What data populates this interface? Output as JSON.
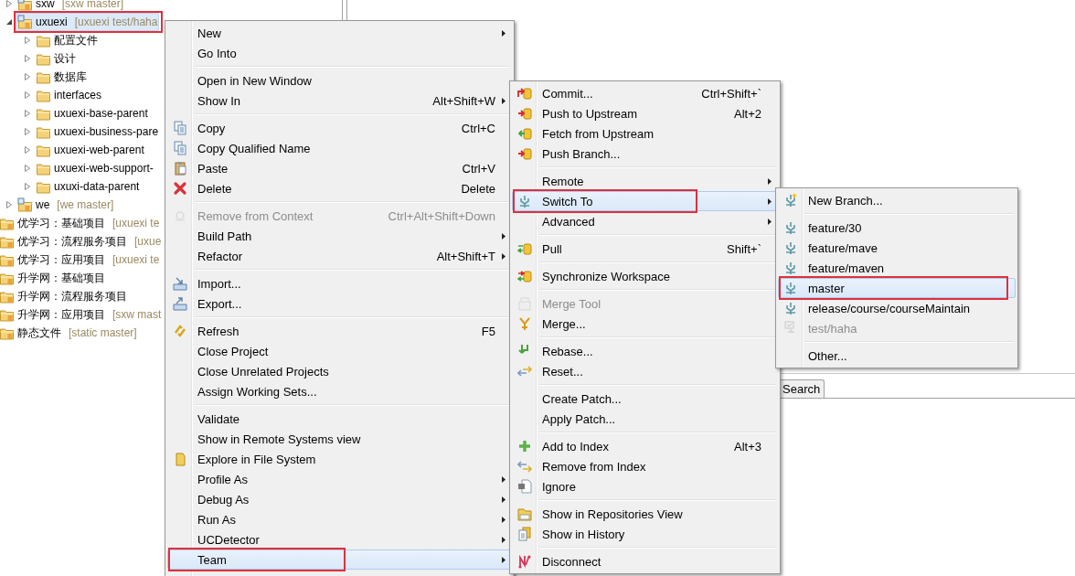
{
  "tree": [
    {
      "kind": "project",
      "label": "sxw",
      "branch": "[sxw master]",
      "expanded": false,
      "selected": false,
      "annotated": false
    },
    {
      "kind": "project",
      "label": "uxuexi",
      "branch": "[uxuexi test/haha",
      "expanded": true,
      "selected": true,
      "annotated": true,
      "children": [
        {
          "kind": "folder",
          "label": "配置文件",
          "expanded": false,
          "selected": false,
          "annotated": false
        },
        {
          "kind": "folder",
          "label": "设计",
          "expanded": false,
          "selected": false,
          "annotated": false
        },
        {
          "kind": "folder",
          "label": "数据库",
          "expanded": false,
          "selected": false,
          "annotated": false
        },
        {
          "kind": "folder",
          "label": "interfaces",
          "expanded": false,
          "selected": false,
          "annotated": false
        },
        {
          "kind": "folder",
          "label": "uxuexi-base-parent",
          "expanded": false,
          "selected": false,
          "annotated": false
        },
        {
          "kind": "folder",
          "label": "uxuexi-business-pare",
          "expanded": false,
          "selected": false,
          "annotated": false
        },
        {
          "kind": "folder",
          "label": "uxuexi-web-parent",
          "expanded": false,
          "selected": false,
          "annotated": false
        },
        {
          "kind": "folder",
          "label": "uxuexi-web-support-",
          "expanded": false,
          "selected": false,
          "annotated": false
        },
        {
          "kind": "folder",
          "label": "uxuxi-data-parent",
          "expanded": false,
          "selected": false,
          "annotated": false
        }
      ]
    },
    {
      "kind": "project",
      "label": "we",
      "branch": "[we master]",
      "expanded": false,
      "selected": false,
      "annotated": false
    },
    {
      "kind": "set",
      "label": "优学习：基础项目",
      "branch": "[uxuexi te",
      "selected": false,
      "annotated": false
    },
    {
      "kind": "set",
      "label": "优学习：流程服务项目",
      "branch": "[uxue",
      "selected": false,
      "annotated": false
    },
    {
      "kind": "set",
      "label": "优学习：应用项目",
      "branch": "[uxuexi te",
      "selected": false,
      "annotated": false
    },
    {
      "kind": "set",
      "label": "升学网：基础项目",
      "selected": false,
      "annotated": false
    },
    {
      "kind": "set",
      "label": "升学网：流程服务项目",
      "selected": false,
      "annotated": false
    },
    {
      "kind": "set",
      "label": "升学网：应用项目",
      "branch": "[sxw mast",
      "selected": false,
      "annotated": false
    },
    {
      "kind": "set",
      "label": "静态文件",
      "branch": "[static master]",
      "selected": false,
      "annotated": false
    }
  ],
  "bottom_tabs": [
    {
      "label": "Search",
      "selected": false
    }
  ],
  "menus": [
    {
      "items": [
        {
          "kind": "item",
          "label": "New",
          "submenu": true,
          "icon": false,
          "disabled": false,
          "selected": false,
          "annotated": false
        },
        {
          "kind": "item",
          "label": "Go Into",
          "submenu": false,
          "icon": false,
          "disabled": false,
          "selected": false,
          "annotated": false
        },
        {
          "kind": "separator"
        },
        {
          "kind": "item",
          "label": "Open in New Window",
          "submenu": false,
          "icon": false,
          "disabled": false,
          "selected": false,
          "annotated": false
        },
        {
          "kind": "item",
          "label": "Show In",
          "shortcut": "Alt+Shift+W",
          "submenu": true,
          "icon": false,
          "disabled": false,
          "selected": false,
          "annotated": false
        },
        {
          "kind": "separator"
        },
        {
          "kind": "item",
          "label": "Copy",
          "shortcut": "Ctrl+C",
          "submenu": false,
          "icon": true,
          "disabled": false,
          "selected": false,
          "annotated": false
        },
        {
          "kind": "item",
          "label": "Copy Qualified Name",
          "submenu": false,
          "icon": true,
          "disabled": false,
          "selected": false,
          "annotated": false
        },
        {
          "kind": "item",
          "label": "Paste",
          "shortcut": "Ctrl+V",
          "submenu": false,
          "icon": true,
          "disabled": false,
          "selected": false,
          "annotated": false
        },
        {
          "kind": "item",
          "label": "Delete",
          "shortcut": "Delete",
          "submenu": false,
          "icon": true,
          "disabled": false,
          "selected": false,
          "annotated": false
        },
        {
          "kind": "separator"
        },
        {
          "kind": "item",
          "label": "Remove from Context",
          "shortcut": "Ctrl+Alt+Shift+Down",
          "submenu": false,
          "icon": true,
          "disabled": true,
          "selected": false,
          "annotated": false
        },
        {
          "kind": "item",
          "label": "Build Path",
          "submenu": true,
          "icon": false,
          "disabled": false,
          "selected": false,
          "annotated": false
        },
        {
          "kind": "item",
          "label": "Refactor",
          "shortcut": "Alt+Shift+T",
          "submenu": true,
          "icon": false,
          "disabled": false,
          "selected": false,
          "annotated": false
        },
        {
          "kind": "separator"
        },
        {
          "kind": "item",
          "label": "Import...",
          "submenu": false,
          "icon": true,
          "disabled": false,
          "selected": false,
          "annotated": false
        },
        {
          "kind": "item",
          "label": "Export...",
          "submenu": false,
          "icon": true,
          "disabled": false,
          "selected": false,
          "annotated": false
        },
        {
          "kind": "separator"
        },
        {
          "kind": "item",
          "label": "Refresh",
          "shortcut": "F5",
          "submenu": false,
          "icon": true,
          "disabled": false,
          "selected": false,
          "annotated": false
        },
        {
          "kind": "item",
          "label": "Close Project",
          "submenu": false,
          "icon": false,
          "disabled": false,
          "selected": false,
          "annotated": false
        },
        {
          "kind": "item",
          "label": "Close Unrelated Projects",
          "submenu": false,
          "icon": false,
          "disabled": false,
          "selected": false,
          "annotated": false
        },
        {
          "kind": "item",
          "label": "Assign Working Sets...",
          "submenu": false,
          "icon": false,
          "disabled": false,
          "selected": false,
          "annotated": false
        },
        {
          "kind": "separator"
        },
        {
          "kind": "item",
          "label": "Validate",
          "submenu": false,
          "icon": false,
          "disabled": false,
          "selected": false,
          "annotated": false
        },
        {
          "kind": "item",
          "label": "Show in Remote Systems view",
          "submenu": false,
          "icon": false,
          "disabled": false,
          "selected": false,
          "annotated": false
        },
        {
          "kind": "item",
          "label": "Explore in File System",
          "submenu": false,
          "icon": true,
          "disabled": false,
          "selected": false,
          "annotated": false
        },
        {
          "kind": "item",
          "label": "Profile As",
          "submenu": true,
          "icon": false,
          "disabled": false,
          "selected": false,
          "annotated": false
        },
        {
          "kind": "item",
          "label": "Debug As",
          "submenu": true,
          "icon": false,
          "disabled": false,
          "selected": false,
          "annotated": false
        },
        {
          "kind": "item",
          "label": "Run As",
          "submenu": true,
          "icon": false,
          "disabled": false,
          "selected": false,
          "annotated": false
        },
        {
          "kind": "item",
          "label": "UCDetector",
          "submenu": true,
          "icon": false,
          "disabled": false,
          "selected": false,
          "annotated": false
        },
        {
          "kind": "item",
          "label": "Team",
          "submenu": true,
          "icon": false,
          "disabled": false,
          "selected": true,
          "annotated": true
        }
      ]
    },
    {
      "items": [
        {
          "kind": "item",
          "label": "Commit...",
          "shortcut": "Ctrl+Shift+`",
          "submenu": false,
          "icon": true,
          "disabled": false,
          "selected": false,
          "annotated": false
        },
        {
          "kind": "item",
          "label": "Push to Upstream",
          "shortcut": "Alt+2",
          "submenu": false,
          "icon": true,
          "disabled": false,
          "selected": false,
          "annotated": false
        },
        {
          "kind": "item",
          "label": "Fetch from Upstream",
          "submenu": false,
          "icon": true,
          "disabled": false,
          "selected": false,
          "annotated": false
        },
        {
          "kind": "item",
          "label": "Push Branch...",
          "submenu": false,
          "icon": true,
          "disabled": false,
          "selected": false,
          "annotated": false
        },
        {
          "kind": "separator"
        },
        {
          "kind": "item",
          "label": "Remote",
          "submenu": true,
          "icon": false,
          "disabled": false,
          "selected": false,
          "annotated": false
        },
        {
          "kind": "item",
          "label": "Switch To",
          "submenu": true,
          "icon": true,
          "disabled": false,
          "selected": true,
          "annotated": true
        },
        {
          "kind": "item",
          "label": "Advanced",
          "submenu": true,
          "icon": false,
          "disabled": false,
          "selected": false,
          "annotated": false
        },
        {
          "kind": "separator"
        },
        {
          "kind": "item",
          "label": "Pull",
          "shortcut": "Shift+`",
          "submenu": false,
          "icon": true,
          "disabled": false,
          "selected": false,
          "annotated": false
        },
        {
          "kind": "separator"
        },
        {
          "kind": "item",
          "label": "Synchronize Workspace",
          "submenu": false,
          "icon": true,
          "disabled": false,
          "selected": false,
          "annotated": false
        },
        {
          "kind": "separator"
        },
        {
          "kind": "item",
          "label": "Merge Tool",
          "submenu": false,
          "icon": true,
          "disabled": true,
          "selected": false,
          "annotated": false
        },
        {
          "kind": "item",
          "label": "Merge...",
          "submenu": false,
          "icon": true,
          "disabled": false,
          "selected": false,
          "annotated": false
        },
        {
          "kind": "separator"
        },
        {
          "kind": "item",
          "label": "Rebase...",
          "submenu": false,
          "icon": true,
          "disabled": false,
          "selected": false,
          "annotated": false
        },
        {
          "kind": "item",
          "label": "Reset...",
          "submenu": false,
          "icon": true,
          "disabled": false,
          "selected": false,
          "annotated": false
        },
        {
          "kind": "separator"
        },
        {
          "kind": "item",
          "label": "Create Patch...",
          "submenu": false,
          "icon": false,
          "disabled": false,
          "selected": false,
          "annotated": false
        },
        {
          "kind": "item",
          "label": "Apply Patch...",
          "submenu": false,
          "icon": false,
          "disabled": false,
          "selected": false,
          "annotated": false
        },
        {
          "kind": "separator"
        },
        {
          "kind": "item",
          "label": "Add to Index",
          "shortcut": "Alt+3",
          "submenu": false,
          "icon": true,
          "disabled": false,
          "selected": false,
          "annotated": false
        },
        {
          "kind": "item",
          "label": "Remove from Index",
          "submenu": false,
          "icon": true,
          "disabled": false,
          "selected": false,
          "annotated": false
        },
        {
          "kind": "item",
          "label": "Ignore",
          "submenu": false,
          "icon": true,
          "disabled": false,
          "selected": false,
          "annotated": false
        },
        {
          "kind": "separator"
        },
        {
          "kind": "item",
          "label": "Show in Repositories View",
          "submenu": false,
          "icon": true,
          "disabled": false,
          "selected": false,
          "annotated": false
        },
        {
          "kind": "item",
          "label": "Show in History",
          "submenu": false,
          "icon": true,
          "disabled": false,
          "selected": false,
          "annotated": false
        },
        {
          "kind": "separator"
        },
        {
          "kind": "item",
          "label": "Disconnect",
          "submenu": false,
          "icon": true,
          "disabled": false,
          "selected": false,
          "annotated": false
        }
      ]
    },
    {
      "items": [
        {
          "kind": "item",
          "label": "New Branch...",
          "submenu": false,
          "icon": true,
          "disabled": false,
          "selected": false,
          "annotated": false
        },
        {
          "kind": "separator"
        },
        {
          "kind": "item",
          "label": "feature/30",
          "submenu": false,
          "icon": true,
          "disabled": false,
          "selected": false,
          "annotated": false
        },
        {
          "kind": "item",
          "label": "feature/mave",
          "submenu": false,
          "icon": true,
          "disabled": false,
          "selected": false,
          "annotated": false
        },
        {
          "kind": "item",
          "label": "feature/maven",
          "submenu": false,
          "icon": true,
          "disabled": false,
          "selected": false,
          "annotated": false
        },
        {
          "kind": "item",
          "label": "master",
          "submenu": false,
          "icon": true,
          "disabled": false,
          "selected": true,
          "annotated": true
        },
        {
          "kind": "item",
          "label": "release/course/courseMaintain",
          "submenu": false,
          "icon": true,
          "disabled": false,
          "selected": false,
          "annotated": false
        },
        {
          "kind": "item",
          "label": "test/haha",
          "submenu": false,
          "icon": true,
          "disabled": true,
          "selected": false,
          "annotated": false
        },
        {
          "kind": "separator"
        },
        {
          "kind": "item",
          "label": "Other...",
          "submenu": false,
          "icon": false,
          "disabled": false,
          "selected": false,
          "annotated": false
        }
      ]
    }
  ]
}
